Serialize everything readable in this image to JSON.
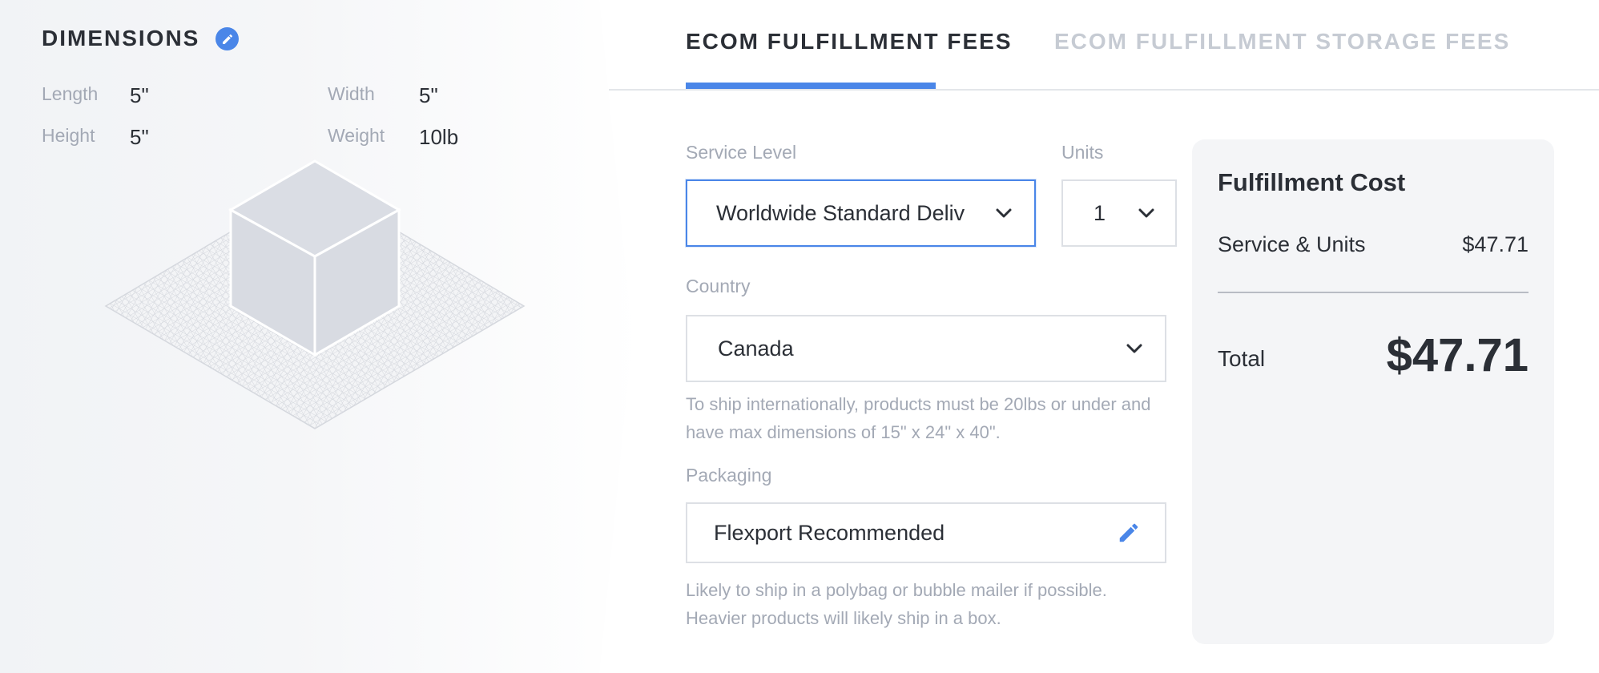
{
  "dimensions": {
    "title": "DIMENSIONS",
    "fields": [
      {
        "label": "Length",
        "value": "5\""
      },
      {
        "label": "Width",
        "value": "5\""
      },
      {
        "label": "Height",
        "value": "5\""
      },
      {
        "label": "Weight",
        "value": "10lb"
      }
    ]
  },
  "tabs": [
    {
      "label": "ECOM FULFILLMENT FEES",
      "active": true
    },
    {
      "label": "ECOM FULFILLMENT STORAGE FEES",
      "active": false
    }
  ],
  "form": {
    "service_level": {
      "label": "Service Level",
      "value": "Worldwide Standard Deliv"
    },
    "units": {
      "label": "Units",
      "value": "1"
    },
    "country": {
      "label": "Country",
      "value": "Canada",
      "help": "To ship internationally, products must be 20lbs or under and have max dimensions of 15\" x 24\" x 40\"."
    },
    "packaging": {
      "label": "Packaging",
      "value": "Flexport Recommended",
      "help": "Likely to ship in a polybag or bubble mailer if possible. Heavier products will likely ship in a box."
    }
  },
  "cost": {
    "title": "Fulfillment Cost",
    "row_label": "Service & Units",
    "row_value": "$47.71",
    "total_label": "Total",
    "total_value": "$47.71"
  },
  "colors": {
    "accent": "#4a86e8",
    "text": "#2b2f36",
    "muted": "#a3a9b5",
    "inactive_tab": "#c6cbd3"
  }
}
